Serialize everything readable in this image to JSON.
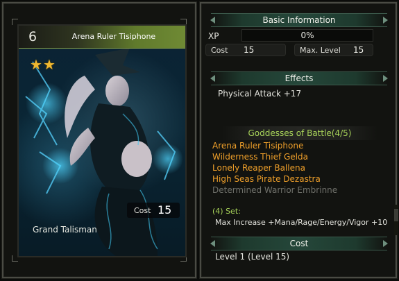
{
  "card": {
    "level": "6",
    "name": "Arena Ruler Tisiphone",
    "stars": 2,
    "star_glyph": "★",
    "cost_label": "Cost",
    "cost_value": "15",
    "type": "Grand Talisman",
    "header_color": "#6f8a34",
    "star_color": "#f0b830"
  },
  "basic_info": {
    "title": "Basic Information",
    "xp_label": "XP",
    "xp_value": "0%",
    "cost_label": "Cost",
    "cost_value": "15",
    "max_level_label": "Max. Level",
    "max_level_value": "15"
  },
  "effects": {
    "title": "Effects",
    "lines": [
      "Physical Attack +17"
    ]
  },
  "set": {
    "title": "Goddesses of Battle(4/5)",
    "members": [
      {
        "name": "Arena Ruler Tisiphone",
        "active": true
      },
      {
        "name": "Wilderness Thief Gelda",
        "active": true
      },
      {
        "name": "Lonely Reaper Ballena",
        "active": true
      },
      {
        "name": "High Seas Pirate Dezastra",
        "active": true
      },
      {
        "name": "Determined Warrior Embrinne",
        "active": false
      }
    ],
    "bonus_label": "(4) Set:",
    "bonus_desc": "Max Increase +Mana/Rage/Energy/Vigor +10",
    "active_color": "#f0a02a",
    "inactive_color": "#6f706a",
    "title_color": "#a9d45a"
  },
  "cost": {
    "title": "Cost",
    "value": "Level 1 (Level 15)"
  }
}
